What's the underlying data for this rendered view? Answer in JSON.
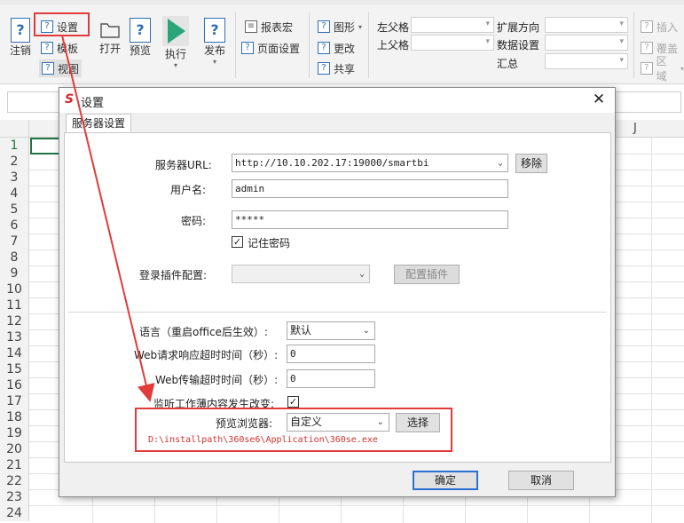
{
  "ribbon": {
    "zhuxiao_label": "注销",
    "shezhi_label": "设置",
    "moban_label": "模板",
    "shitu_label": "视图",
    "dakai_label": "打开",
    "yulan_label": "预览",
    "zhixing_label": "执行",
    "fabu_label": "发布",
    "baobiaohong_label": "报表宏",
    "yemianshezhi_label": "页面设置",
    "tuxing_label": "图形",
    "gengai_label": "更改",
    "gongxiang_label": "共享",
    "zuofuge_label": "左父格",
    "shangfuge_label": "上父格",
    "kuozhanfangxiang_label": "扩展方向",
    "shujushezhi_label": "数据设置",
    "huizong_label": "汇总",
    "charu_label": "插入",
    "fugai_label": "覆盖",
    "quyu_label": "区域"
  },
  "sheet": {
    "rows": [
      "1",
      "2",
      "3",
      "4",
      "5",
      "6",
      "7",
      "8",
      "9",
      "10",
      "11",
      "12",
      "13",
      "14",
      "15",
      "16",
      "17",
      "18",
      "19",
      "20",
      "21",
      "22",
      "23",
      "24"
    ],
    "col_j": "J"
  },
  "dialog": {
    "title": "设置",
    "close_glyph": "✕",
    "tab_label": "服务器设置",
    "server_url_label": "服务器URL:",
    "server_url_value": "http://10.10.202.17:19000/smartbi",
    "remove_label": "移除",
    "username_label": "用户名:",
    "username_value": "admin",
    "password_label": "密码:",
    "password_value": "*****",
    "remember_label": "记住密码",
    "login_plugin_label": "登录插件配置:",
    "config_plugin_label": "配置插件",
    "language_label": "语言（重启office后生效）:",
    "language_value": "默认",
    "web_response_timeout_label": "Web请求响应超时时间（秒）:",
    "web_response_timeout_value": "0",
    "web_transfer_timeout_label": "Web传输超时时间（秒）:",
    "web_transfer_timeout_value": "0",
    "monitor_label": "监听工作薄内容发生改变:",
    "preview_browser_label": "预览浏览器:",
    "preview_browser_value": "自定义",
    "choose_label": "选择",
    "browser_path": "D:\\installpath\\360se6\\Application\\360se.exe",
    "ok_label": "确定",
    "cancel_label": "取消"
  },
  "colors": {
    "annotation_red": "#e23b3b",
    "path_red": "#d0312d",
    "excel_green": "#217346",
    "icon_blue": "#2f6fb3",
    "run_green": "#2aa57a"
  }
}
